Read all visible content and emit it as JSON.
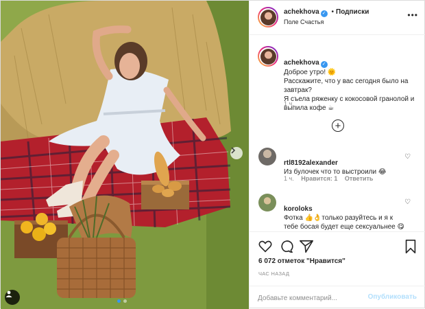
{
  "post": {
    "username": "achekhova",
    "verified_icon": "verified-badge-icon",
    "follow_separator": "•",
    "follow_label": "Подписки",
    "location": "Поле Счастья",
    "more_icon": "more-options-icon"
  },
  "caption": {
    "username": "achekhova",
    "greeting": "Доброе утро! 🌞",
    "text": "Расскажите, что у вас сегодня было на завтрак?\nЯ съела ряженку с кокосовой гранолой и выпила кофе ☕",
    "time": "1 ч."
  },
  "load_more_icon": "plus-circle-icon",
  "comments": [
    {
      "username": "rtl8192alexander",
      "text": "Из булочек что то выстроили 😂",
      "time": "1 ч.",
      "likes": "Нравится: 1",
      "reply": "Ответить"
    },
    {
      "username": "koroloks",
      "text": "Фотка 👍👌только разуйтесь и я к тебе босая будет еще сексуальнее 😋",
      "time": "",
      "likes": "",
      "reply": ""
    }
  ],
  "actions": {
    "likes_count": "6 072 отметок \"Нравится\"",
    "posted_ago": "ЧАС НАЗАД"
  },
  "comment_box": {
    "placeholder": "Добавьте комментарий...",
    "publish_label": "Опубликовать"
  },
  "carousel": {
    "total": 2,
    "active": 1
  },
  "colors": {
    "accent": "#3897f0",
    "publish_disabled": "#b2dffc",
    "text": "#262626",
    "muted": "#8e8e8e",
    "border": "#efefef"
  }
}
